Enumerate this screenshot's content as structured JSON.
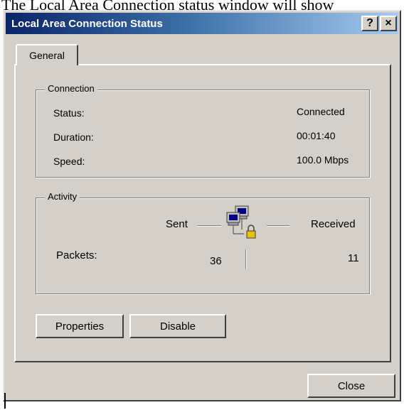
{
  "caption": "The Local Area Connection status window will show",
  "window": {
    "title": "Local Area Connection Status",
    "help_glyph": "?",
    "close_glyph": "×"
  },
  "tabs": [
    {
      "label": "General",
      "active": true
    }
  ],
  "connection": {
    "group_label": "Connection",
    "rows": [
      {
        "label": "Status:",
        "value": "Connected"
      },
      {
        "label": "Duration:",
        "value": "00:01:40"
      },
      {
        "label": "Speed:",
        "value": "100.0 Mbps"
      }
    ]
  },
  "activity": {
    "group_label": "Activity",
    "sent_label": "Sent",
    "received_label": "Received",
    "packets_label": "Packets:",
    "packets_sent": "36",
    "packets_received": "11",
    "icon": "network-computers-icon"
  },
  "buttons": {
    "properties": "Properties",
    "disable": "Disable",
    "close": "Close"
  },
  "colors": {
    "dialog_face": "#d4d0c8",
    "title_start": "#0a246a",
    "title_end": "#a6caf0"
  }
}
